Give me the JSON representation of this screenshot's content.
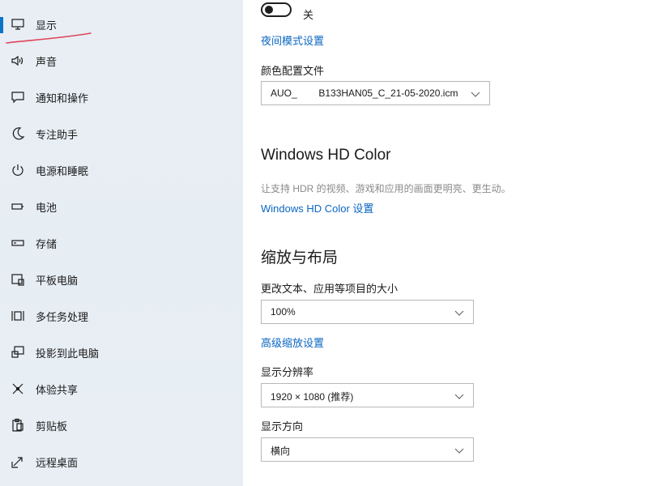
{
  "sidebar": {
    "items": [
      {
        "icon": "monitor-icon",
        "label": "显示",
        "active": true
      },
      {
        "icon": "speaker-icon",
        "label": "声音"
      },
      {
        "icon": "notification-icon",
        "label": "通知和操作"
      },
      {
        "icon": "moon-icon",
        "label": "专注助手"
      },
      {
        "icon": "power-icon",
        "label": "电源和睡眠"
      },
      {
        "icon": "battery-icon",
        "label": "电池"
      },
      {
        "icon": "storage-icon",
        "label": "存储"
      },
      {
        "icon": "tablet-icon",
        "label": "平板电脑"
      },
      {
        "icon": "multitask-icon",
        "label": "多任务处理"
      },
      {
        "icon": "project-icon",
        "label": "投影到此电脑"
      },
      {
        "icon": "share-icon",
        "label": "体验共享"
      },
      {
        "icon": "clipboard-icon",
        "label": "剪贴板"
      },
      {
        "icon": "remote-desktop-icon",
        "label": "远程桌面"
      }
    ]
  },
  "colors": {
    "accent": "#0a74c9",
    "link": "#0a66c2",
    "annotation": "#e0455e"
  },
  "main": {
    "night_light": {
      "state_label": "关",
      "settings_link": "夜间模式设置"
    },
    "color_profile": {
      "label": "颜色配置文件",
      "value": "AUO_        B133HAN05_C_21-05-2020.icm"
    },
    "hd_color": {
      "title": "Windows HD Color",
      "description": "让支持 HDR 的视频、游戏和应用的画面更明亮、更生动。",
      "settings_link": "Windows HD Color 设置"
    },
    "scale_layout": {
      "title": "缩放与布局",
      "scale_label": "更改文本、应用等项目的大小",
      "scale_value": "100%",
      "advanced_link": "高级缩放设置",
      "resolution_label": "显示分辨率",
      "resolution_value": "1920 × 1080 (推荐)",
      "orientation_label": "显示方向",
      "orientation_value": "横向"
    }
  }
}
